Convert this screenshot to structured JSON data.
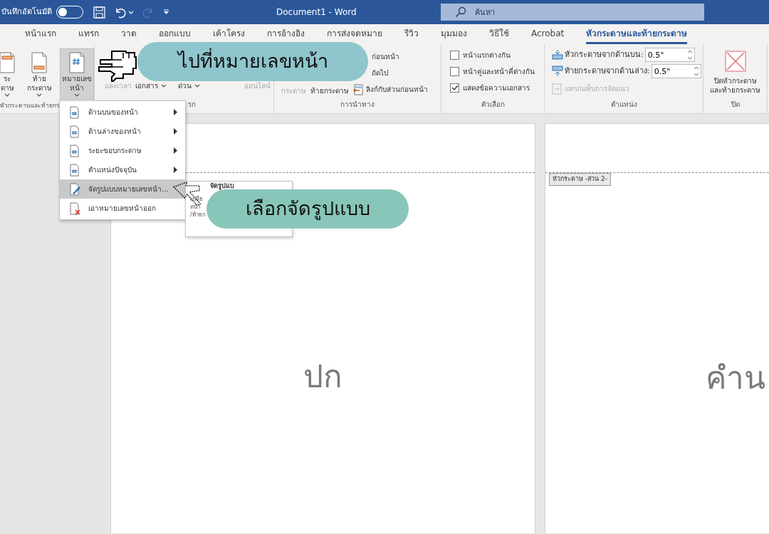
{
  "title_bar": {
    "autosave_label": "บันทึกอัตโนมัติ",
    "autosave_on": false,
    "title": "Document1  -  Word",
    "search": {
      "placeholder": "ค้นหา"
    }
  },
  "tabs": [
    {
      "label": "หน้าแรก",
      "selected": false
    },
    {
      "label": "แทรก",
      "selected": false
    },
    {
      "label": "วาด",
      "selected": false
    },
    {
      "label": "ออกแบบ",
      "selected": false
    },
    {
      "label": "เค้าโครง",
      "selected": false
    },
    {
      "label": "การอ้างอิง",
      "selected": false
    },
    {
      "label": "การส่งจดหมาย",
      "selected": false
    },
    {
      "label": "รีวิว",
      "selected": false
    },
    {
      "label": "มุมมอง",
      "selected": false
    },
    {
      "label": "วิธีใช้",
      "selected": false
    },
    {
      "label": "Acrobat",
      "selected": false
    },
    {
      "label": "หัวกระดาษและท้ายกระดาษ",
      "selected": true
    }
  ],
  "ribbon": {
    "groups": [
      {
        "kind": "large",
        "label": "หัวกระดาษและท้ายกร",
        "buttons": [
          {
            "label": "ระดาษ",
            "selected": false
          },
          {
            "label": "ท้ายกระดาษ",
            "selected": false
          },
          {
            "label": "หมายเลข\nหน้า",
            "selected": true
          }
        ]
      },
      {
        "kind": "covered",
        "label": "รก",
        "buttons": [
          {
            "label": "และเวลา",
            "disabled": true,
            "caret": false
          },
          {
            "label": "เอกสาร",
            "disabled": false,
            "caret": true
          },
          {
            "label": "ด่วน",
            "disabled": false,
            "caret": true
          },
          {
            "label": "ออนไลน์",
            "disabled": true,
            "caret": false
          }
        ]
      },
      {
        "kind": "nav",
        "label": "การนำทาง",
        "buttons": [
          {
            "label": "กระดาษ",
            "disabled": true
          },
          {
            "label": "ท้ายกระดาษ",
            "disabled": false
          }
        ],
        "small": [
          {
            "label": "ก่อนหน้า"
          },
          {
            "label": "ถัดไป"
          },
          {
            "label": "ลิงก์กับส่วนก่อนหน้า"
          }
        ]
      },
      {
        "kind": "options",
        "label": "ตัวเลือก",
        "checkboxes": [
          {
            "label": "หน้าแรกต่างกัน",
            "checked": false
          },
          {
            "label": "หน้าคู่และหน้าคี่ต่างกัน",
            "checked": false
          },
          {
            "label": "แสดงข้อความเอกสาร",
            "checked": true
          }
        ]
      },
      {
        "kind": "position",
        "label": "ตำแหน่ง",
        "spinners": [
          {
            "label": "หัวกระดาษจากด้านบน:",
            "value": "0.5\""
          },
          {
            "label": "ท้ายกระดาษจากด้านล่าง:",
            "value": "0.5\""
          }
        ],
        "button": {
          "label": "แทรกแท็บการจัดแนว",
          "disabled": true
        }
      },
      {
        "kind": "close",
        "label": "ปิด",
        "button": {
          "label": "ปิดหัวกระดาษ\nและท้ายกระดาษ"
        }
      }
    ]
  },
  "page_number_menu": {
    "items": [
      {
        "label": "ด้านบนของหน้า",
        "submenu": true,
        "selected": false
      },
      {
        "label": "ด้านล่างของหน้า",
        "submenu": true,
        "selected": false
      },
      {
        "label": "ระยะขอบกระดาษ",
        "submenu": true,
        "selected": false
      },
      {
        "label": "ตำแหน่งปัจจุบัน",
        "submenu": true,
        "selected": false
      },
      {
        "label": "จัดรูปแบบหมายเลขหน้า...",
        "submenu": false,
        "selected": true
      },
      {
        "label": "เอาหมายเลขหน้าออก",
        "submenu": false,
        "selected": false
      }
    ]
  },
  "tooltip": {
    "title": "จัดรูปแบ",
    "lines": [
      "เปลี่ย",
      "หน้า",
      "/ท้ายก"
    ]
  },
  "callouts": [
    {
      "text": "ไปที่หมายเลขหน้า",
      "color": "#8fc5cc"
    },
    {
      "text": "เลือกจัดรูปแบบ",
      "color": "#88c6b9"
    }
  ],
  "pages": [
    {
      "text": "ปก"
    },
    {
      "header_tag": "หัวกระดาษ -ส่วน 2-",
      "text": "คำน"
    }
  ]
}
